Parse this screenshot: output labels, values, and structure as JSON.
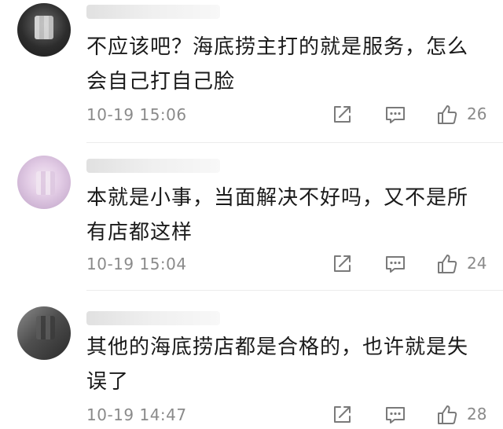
{
  "comments": [
    {
      "text": "不应该吧？海底捞主打的就是服务，怎么会自己打自己脸",
      "time": "10-19 15:06",
      "likes": "26"
    },
    {
      "text": "本就是小事，当面解决不好吗，又不是所有店都这样",
      "time": "10-19 15:04",
      "likes": "24"
    },
    {
      "text": "其他的海底捞店都是合格的，也许就是失误了",
      "time": "10-19 14:47",
      "likes": "28"
    }
  ],
  "colors": {
    "text": "#1a1a1a",
    "meta": "#8a8a8a",
    "icon": "#7a7a7a",
    "divider": "#ececec"
  },
  "icons": {
    "share": "share-icon",
    "reply": "comment-icon",
    "like": "thumbs-up-icon"
  }
}
